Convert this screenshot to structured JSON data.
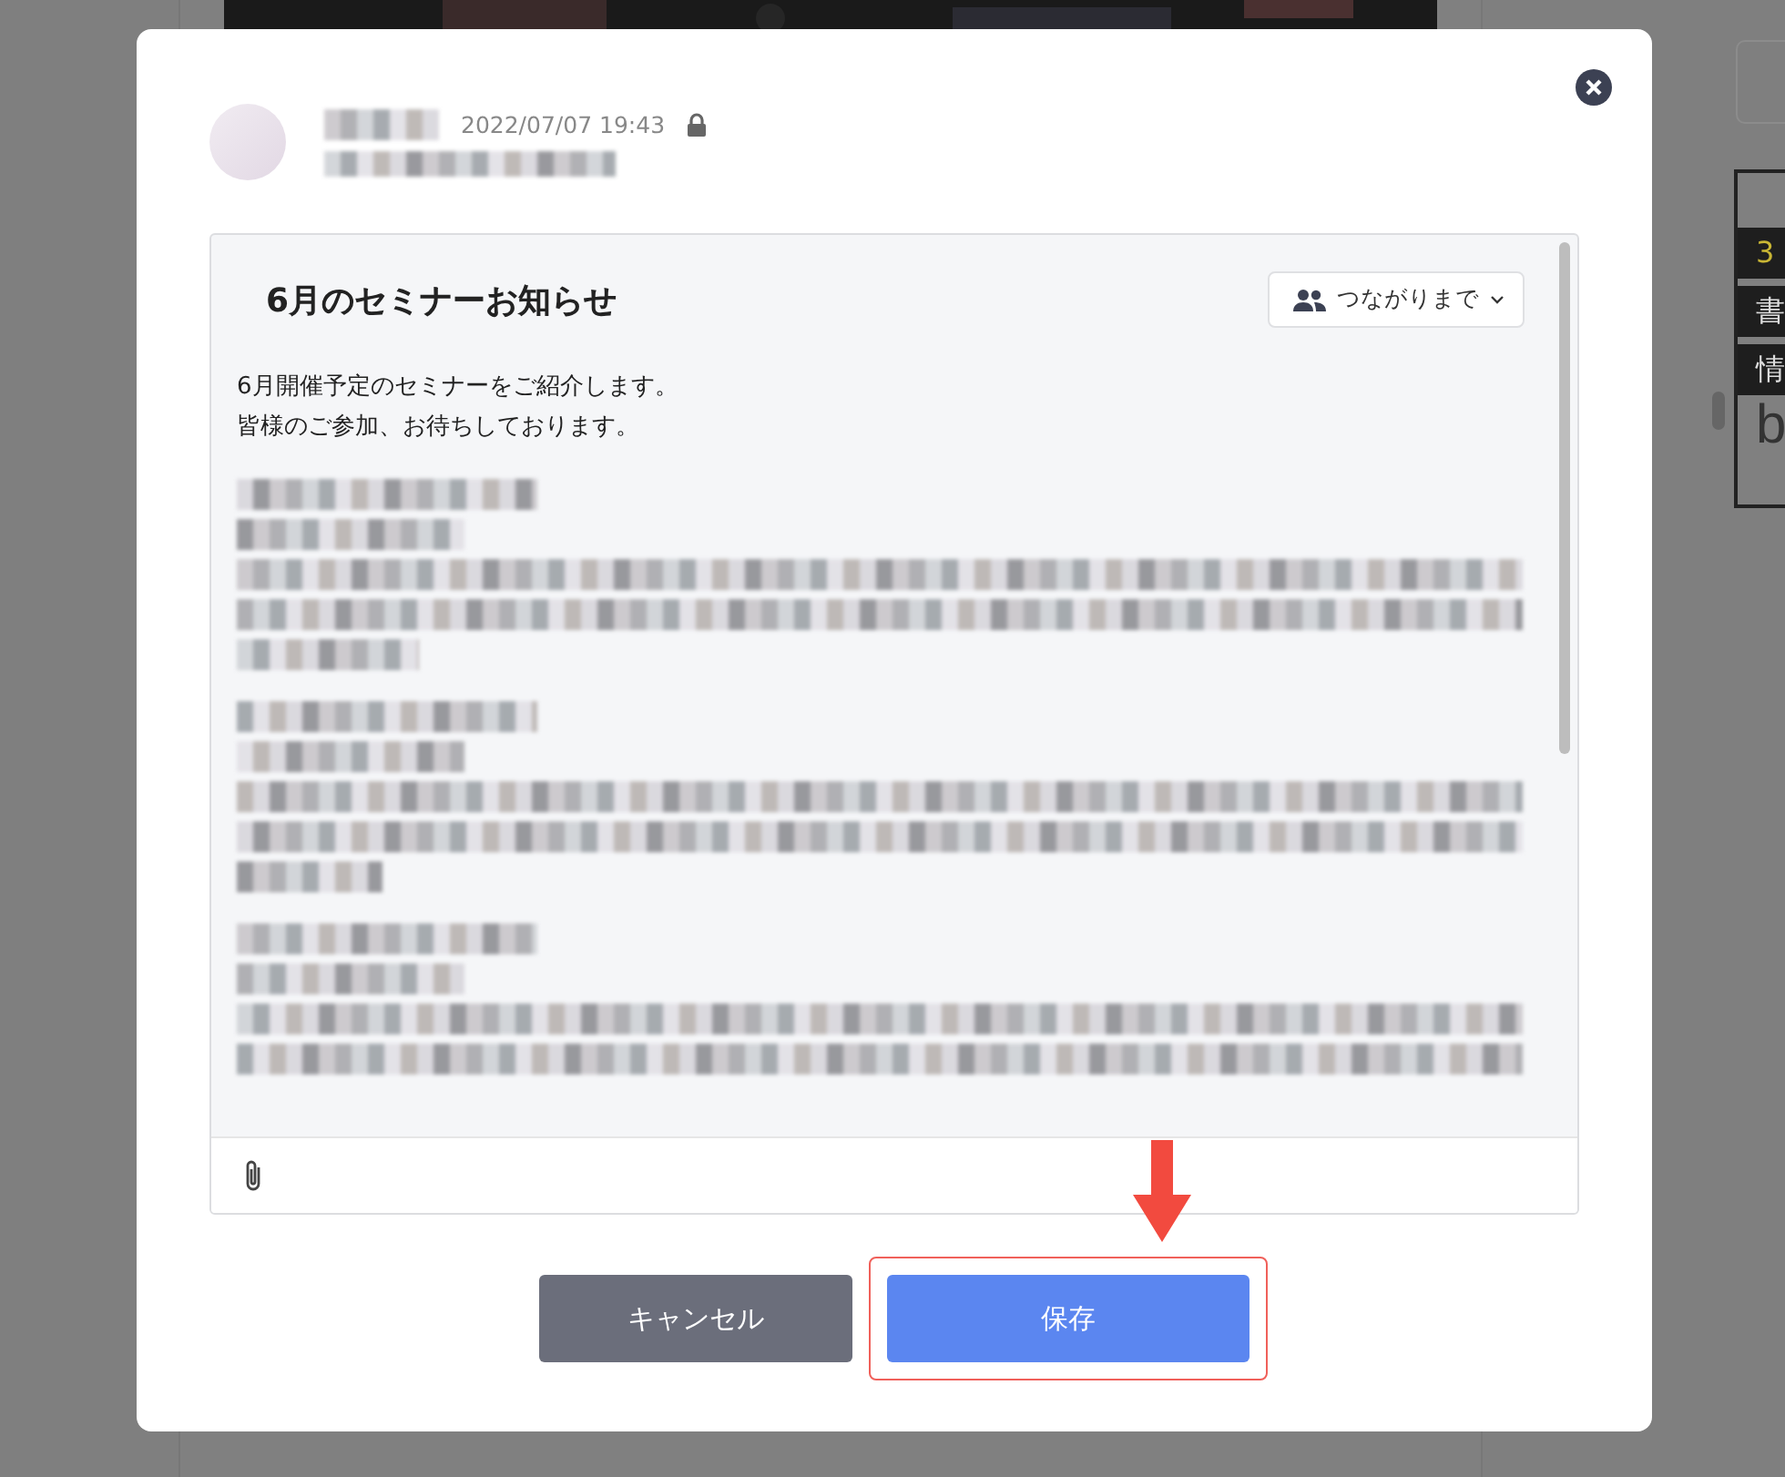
{
  "background": {
    "side_fragments": [
      "3",
      "書",
      "情",
      "b"
    ]
  },
  "dialog": {
    "post_time": "2022/07/07 19:43",
    "private": true,
    "editor": {
      "title": "6月のセミナーお知らせ",
      "audience": "つながりまで",
      "body": [
        "6月開催予定のセミナーをご紹介します。",
        "皆様のご参加、お待ちしております。"
      ]
    },
    "buttons": [
      {
        "label": "キャンセル",
        "kind": "cancel",
        "highlighted": false
      },
      {
        "label": "保存",
        "kind": "save",
        "highlighted": true
      }
    ]
  }
}
